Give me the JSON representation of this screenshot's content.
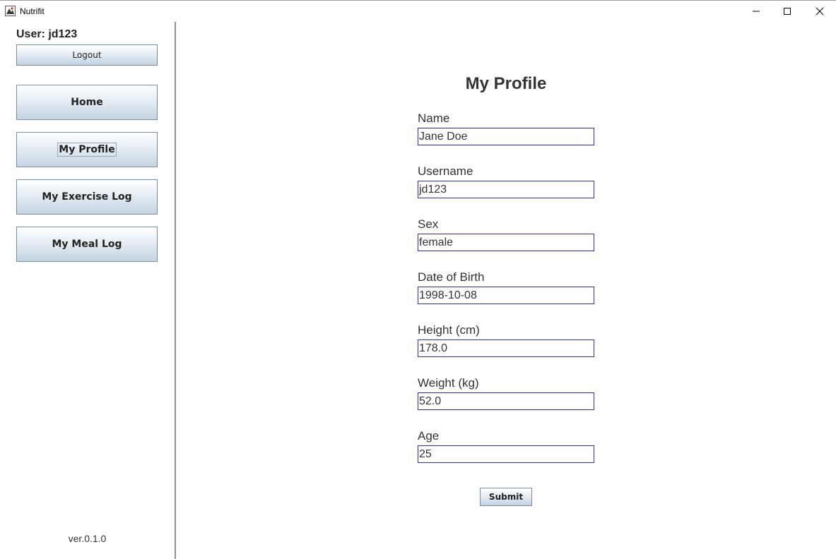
{
  "window": {
    "title": "Nutrifit",
    "minimize_icon": "minimize-icon",
    "maximize_icon": "maximize-icon",
    "close_icon": "close-icon"
  },
  "sidebar": {
    "user_label": "User: jd123",
    "logout_label": "Logout",
    "nav": [
      {
        "label": "Home"
      },
      {
        "label": "My Profile"
      },
      {
        "label": "My Exercise Log"
      },
      {
        "label": "My Meal Log"
      }
    ],
    "version": "ver.0.1.0"
  },
  "profile": {
    "title": "My Profile",
    "fields": [
      {
        "label": "Name",
        "value": "Jane Doe"
      },
      {
        "label": "Username",
        "value": "jd123"
      },
      {
        "label": "Sex",
        "value": "female"
      },
      {
        "label": "Date of Birth",
        "value": "1998-10-08"
      },
      {
        "label": "Height (cm)",
        "value": "178.0"
      },
      {
        "label": "Weight (kg)",
        "value": "52.0"
      },
      {
        "label": "Age",
        "value": "25"
      }
    ],
    "submit_label": "Submit"
  },
  "colors": {
    "input_border": "#2b2bb8",
    "button_gradient_bottom": "#c4d3e2",
    "divider": "#8e8e8e"
  }
}
